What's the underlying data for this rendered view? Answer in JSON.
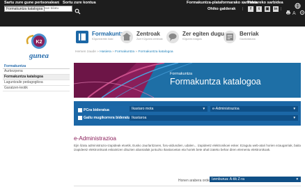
{
  "topbar": {
    "login_link": "Sartu zure gune pertsonalean",
    "account_link": "Sortu zure kontua",
    "login_tooltip": "Formakuntza katalogoa",
    "search": {
      "placeholder": "K2gunearako web orrialdean bilatu"
    },
    "platform_link": "Formakuntza-plataformarako sarbidea",
    "postareko_link": "Postareko sarbidea",
    "greeting": "Ohiko galderak",
    "social": [
      "f",
      "t",
      "▣",
      "in"
    ],
    "utility_icons": [
      "print-icon",
      "text-size-icon",
      "settings-icon"
    ]
  },
  "colors": {
    "topbar": "#1d1d1d",
    "accent_blue": "#1b67a6",
    "dark_blue": "#0f4f86",
    "link_blue": "#2b6fae",
    "section_title": "#8a1e5a"
  },
  "logo": {
    "letters": "K2",
    "wordmark": "gunea"
  },
  "nav": [
    {
      "title": "Formakuntza",
      "subtitle": "K2gunearekin ikasi",
      "icon": "book-icon"
    },
    {
      "title": "Zentroak",
      "subtitle": "Zure K2gunea zentroak",
      "icon": "building-icon"
    },
    {
      "title": "Zer egiten dugu",
      "subtitle": "K2gunea ezagutu",
      "icon": "speech-bubble-icon"
    },
    {
      "title": "Berriak",
      "subtitle": "Gaurkotasuna",
      "icon": "newspaper-icon"
    }
  ],
  "breadcrumb": {
    "home": "Hemen zaude »",
    "crumbs": [
      "Hasiera",
      "Formakuntza",
      "Formakuntza katalogoa"
    ]
  },
  "sidebar": {
    "title": "Formakuntza",
    "items": [
      "Aurkezpena",
      "Formakuntza katalogoa",
      "Laguntzaile pedagogikoa",
      "Garatzen-leotik"
    ],
    "active_index": 1
  },
  "banner": {
    "small_text": "Formakuntza",
    "title": "Formakuntza katalogoa"
  },
  "filters": {
    "checkbox1": "PCra bideratua",
    "checkbox2": "Gailu mugikorrera bideratua",
    "select_type": "Ikastaro mota",
    "select_topic": "e-Administrazioa",
    "select_courses": "Ikastaroa"
  },
  "section": {
    "title": "e-Administrazioa",
    "description": "Ejin lizatu administrazio-izapideak etxetik, Eusko Jaurlaritzaren, foru-aldundien, udalen... izapideetz elektronikoei esker. Ezagutu web-atari horien ezaugarriak, baita izapideetz elektronikoak eskaintzen dituzten abantailak juntuzko ikastaroetan eta horiek bete ahal izateko behar diren elementu elektronikoak."
  },
  "sort": {
    "label": "Honen arabera ordenatu:",
    "value": "Izenburua: A-tik Z-ra"
  }
}
